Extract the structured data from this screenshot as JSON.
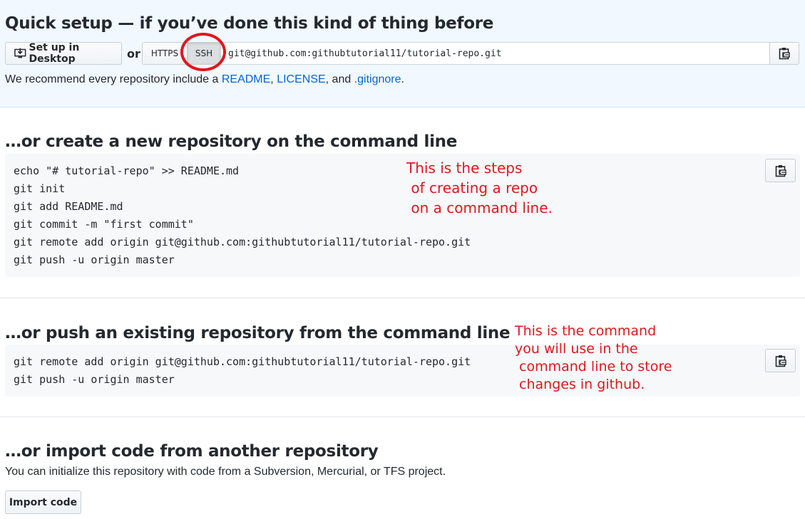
{
  "quick_setup": {
    "title": "Quick setup — if you’ve done this kind of thing before",
    "desktop_button": "Set up in Desktop",
    "or": "or",
    "protocols": [
      "HTTPS",
      "SSH"
    ],
    "selected_protocol": "SSH",
    "clone_url": "git@github.com:githubtutorial11/tutorial-repo.git",
    "recommend": {
      "prefix": "We recommend every repository include a ",
      "readme": "README",
      "sep1": ", ",
      "license": "LICENSE",
      "sep2": ", and ",
      "gitignore": ".gitignore",
      "suffix": "."
    }
  },
  "new_repo": {
    "title": "…or create a new repository on the command line",
    "code": "echo \"# tutorial-repo\" >> README.md\ngit init\ngit add README.md\ngit commit -m \"first commit\"\ngit remote add origin git@github.com:githubtutorial11/tutorial-repo.git\ngit push -u origin master",
    "annotation": "This is the steps\n of creating a repo\n on a command line."
  },
  "push_existing": {
    "title": "…or push an existing repository from the command line",
    "code": "git remote add origin git@github.com:githubtutorial11/tutorial-repo.git\ngit push -u origin master",
    "annotation": "This is the command\nyou will use in the\n command line to store\n changes in github."
  },
  "import": {
    "title": "…or import code from another repository",
    "description": "You can initialize this repository with code from a Subversion, Mercurial, or TFS project.",
    "button": "Import code"
  },
  "colors": {
    "annotation_red": "#e0171e",
    "link_blue": "#0366d6",
    "quick_bg": "#f1f8ff"
  }
}
